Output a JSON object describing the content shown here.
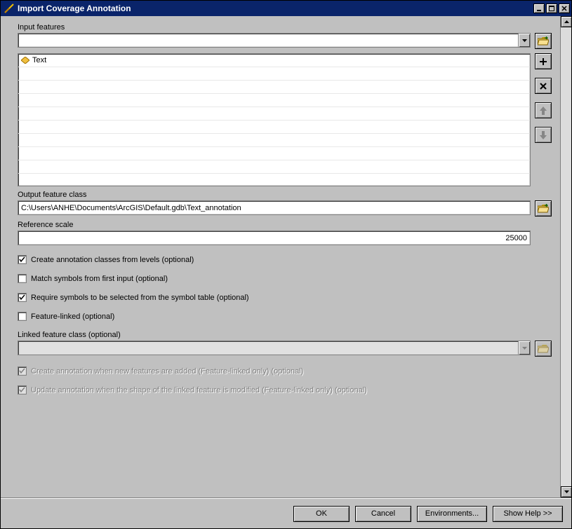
{
  "window": {
    "title": "Import Coverage Annotation"
  },
  "labels": {
    "input_features": "Input features",
    "output_feature_class": "Output feature class",
    "reference_scale": "Reference scale",
    "linked_feature_class": "Linked feature class (optional)"
  },
  "values": {
    "input_features": "",
    "output_feature_class": "C:\\Users\\ANHE\\Documents\\ArcGIS\\Default.gdb\\Text_annotation",
    "reference_scale": "25000",
    "linked_feature_class": ""
  },
  "list": {
    "item0": "Text"
  },
  "checks": {
    "create_classes": {
      "label": "Create annotation classes from levels (optional)",
      "checked": true,
      "enabled": true
    },
    "match_symbols": {
      "label": "Match symbols from first input (optional)",
      "checked": false,
      "enabled": true
    },
    "require_symbols": {
      "label": "Require symbols to be selected from the symbol table (optional)",
      "checked": true,
      "enabled": true
    },
    "feature_linked": {
      "label": "Feature-linked (optional)",
      "checked": false,
      "enabled": true
    },
    "create_on_new": {
      "label": "Create annotation when new features are added (Feature-linked only) (optional)",
      "checked": true,
      "enabled": false
    },
    "update_on_shape": {
      "label": "Update annotation when the shape of the linked feature is modified (Feature-linked only) (optional)",
      "checked": true,
      "enabled": false
    }
  },
  "footer": {
    "ok": "OK",
    "cancel": "Cancel",
    "environments": "Environments...",
    "show_help": "Show Help >>"
  }
}
